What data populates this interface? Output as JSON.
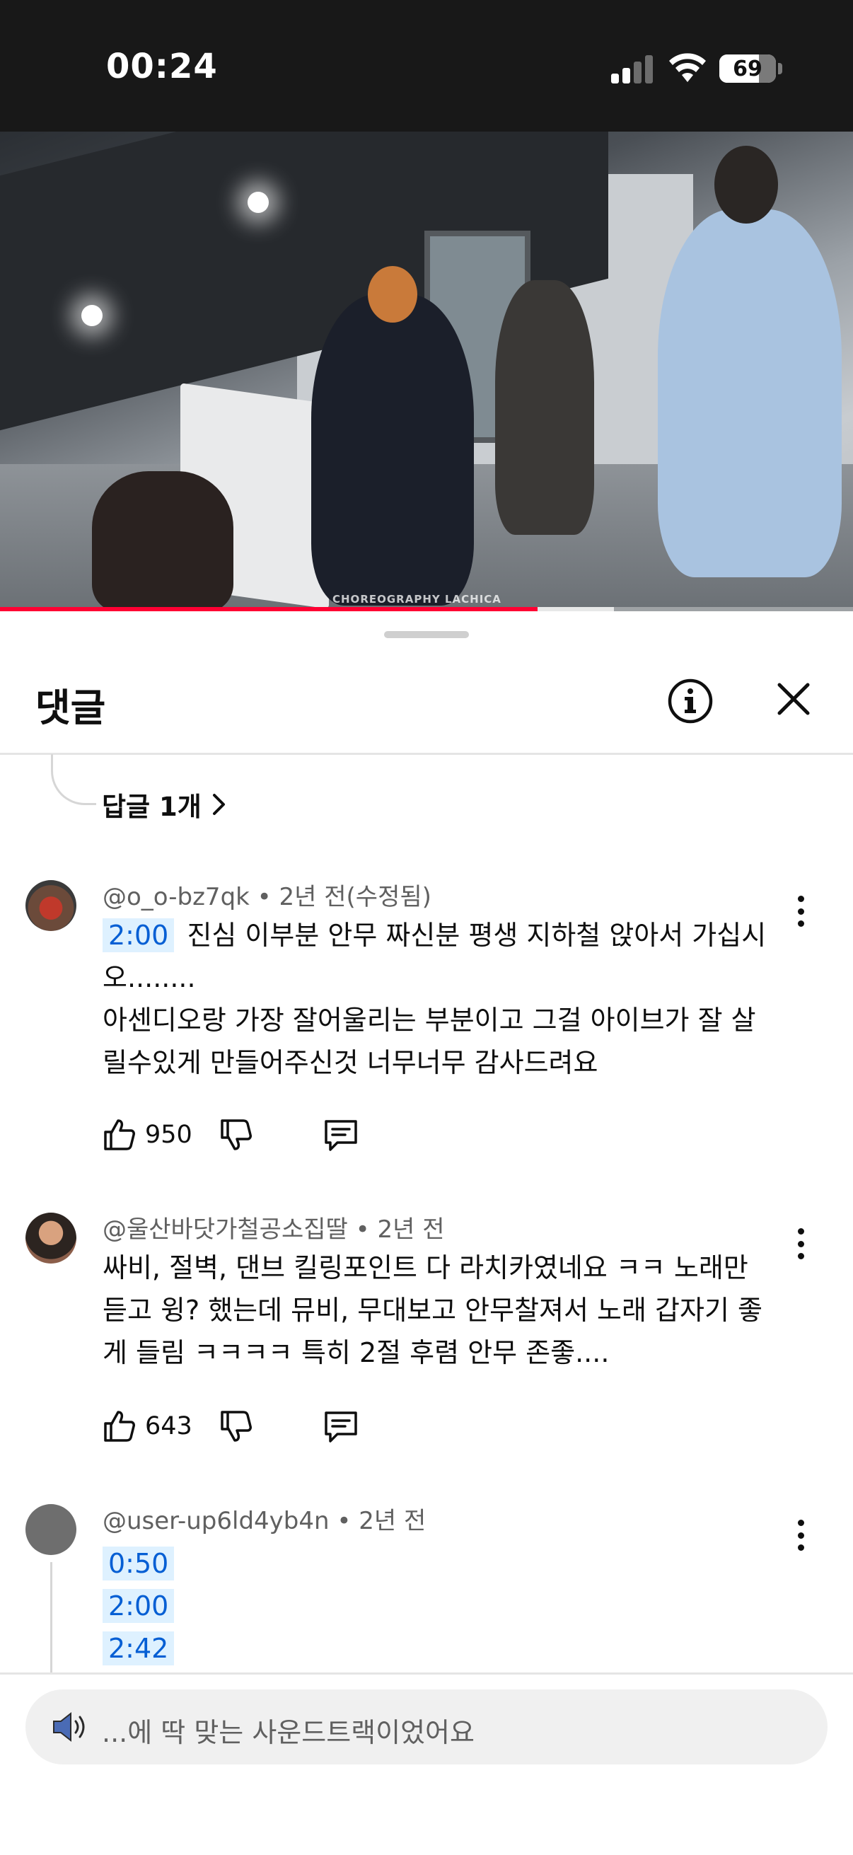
{
  "status_bar": {
    "time": "00:24",
    "battery": "69",
    "signal_bars": 2,
    "signal_total": 4
  },
  "video": {
    "watermark": "CHOREOGRAPHY LACHICA",
    "progress_played": 0.63,
    "progress_buffered": 0.72
  },
  "comments_panel": {
    "title": "댓글",
    "info_icon": "info-icon",
    "close_icon": "close-icon",
    "replies_link": "답글 1개"
  },
  "comments": [
    {
      "author": "@o_o-bz7qk",
      "time": "2년 전(수정됨)",
      "timestamp": "2:00",
      "lines": [
        "진심 이부분 안무 짜신분 평생 지하철 앉아서 가십시",
        "오........",
        "아센디오랑 가장 잘어울리는 부분이고 그걸 아이브가 잘 살",
        "릴수있게 만들어주신것 너무너무 감사드려요"
      ],
      "likes": "950"
    },
    {
      "author": "@울산바닷가철공소집딸",
      "time": "2년 전",
      "lines": [
        "싸비, 절벽, 댄브 킬링포인트 다 라치카였네요 ㅋㅋ 노래만",
        "듣고 윙? 했는데 뮤비, 무대보고 안무찰져서 노래 갑자기 좋",
        "게 들림 ㅋㅋㅋㅋ 특히 2절 후렴 안무 존좋...."
      ],
      "likes": "643"
    },
    {
      "author": "@user-up6ld4yb4n",
      "time": "2년 전",
      "timestamps": [
        "0:50",
        "2:00",
        "2:42"
      ]
    }
  ],
  "composer": {
    "placeholder": "...에 딱 맞는 사운드트랙이었어요",
    "icon": "speaker-icon"
  },
  "colors": {
    "accent": "#ff0033",
    "link": "#065fd4",
    "timestamp_bg": "#def1ff"
  }
}
